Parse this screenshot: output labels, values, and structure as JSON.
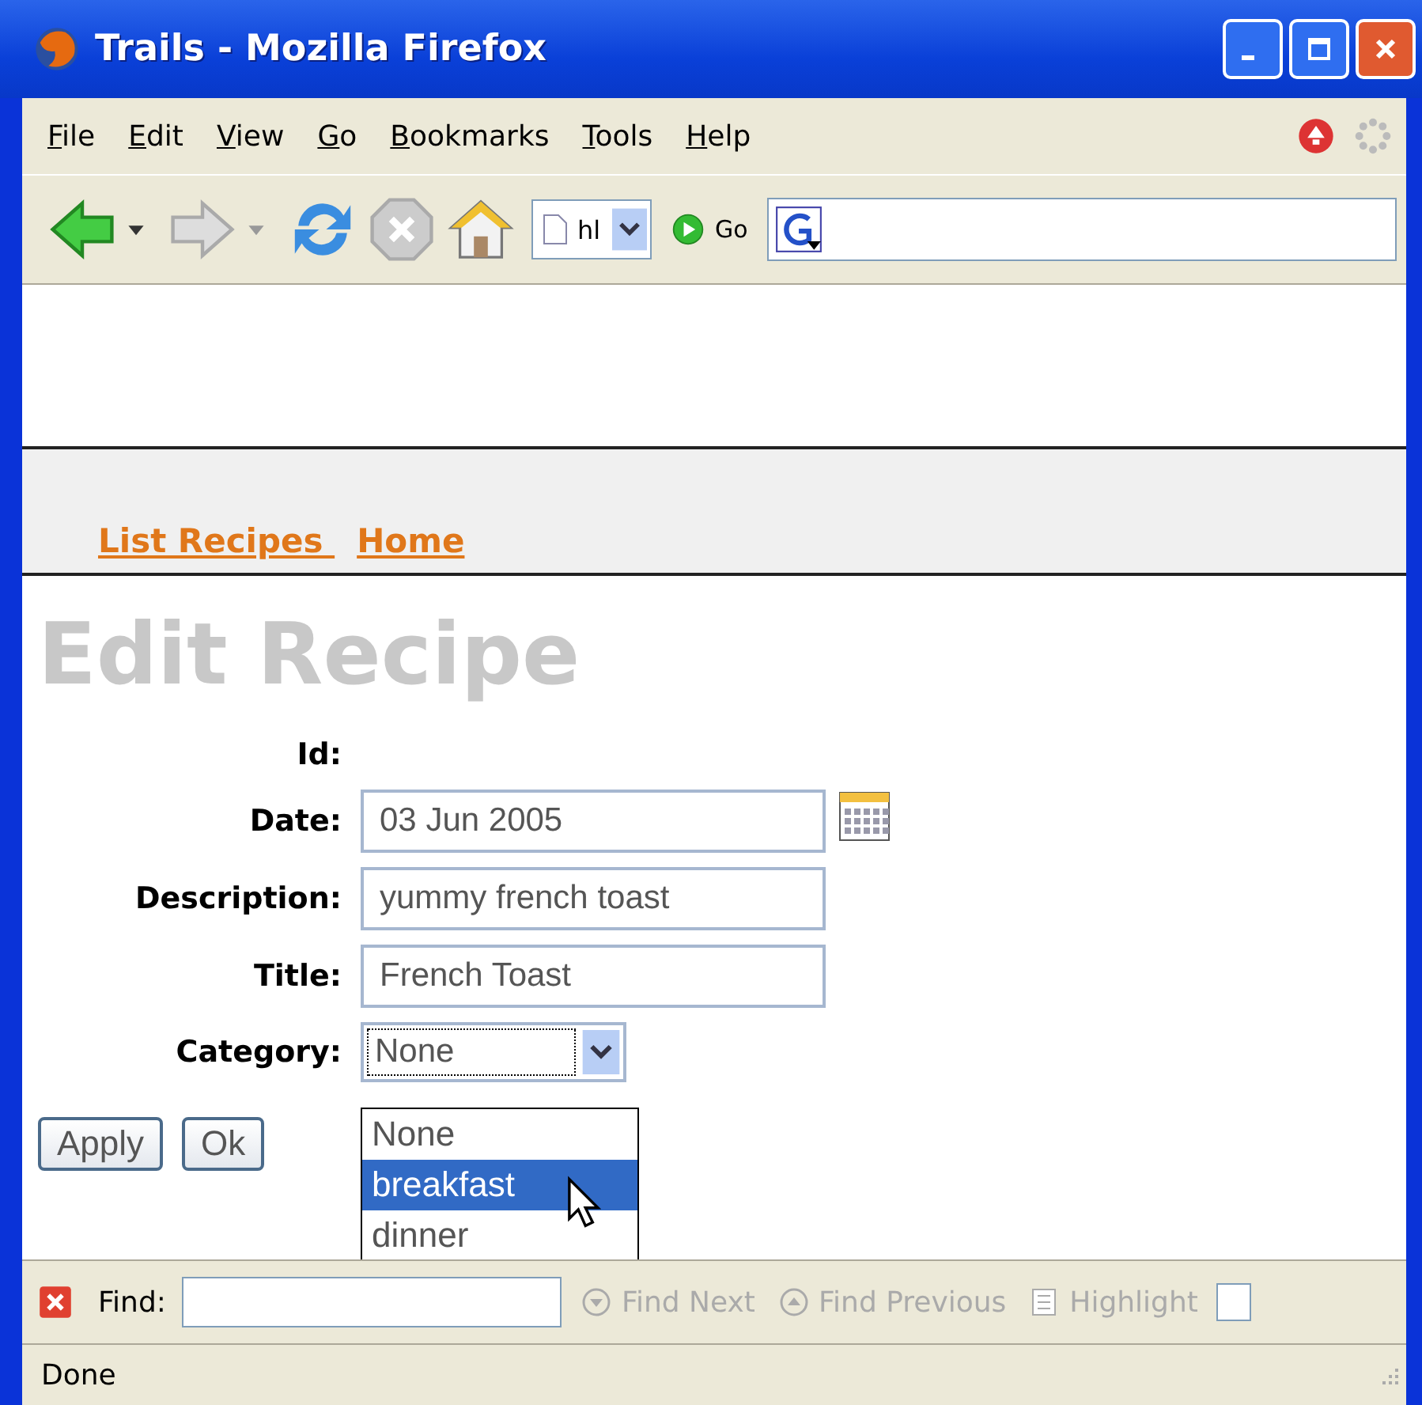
{
  "window": {
    "title": "Trails - Mozilla Firefox"
  },
  "menu": [
    "File",
    "Edit",
    "View",
    "Go",
    "Bookmarks",
    "Tools",
    "Help"
  ],
  "toolbar": {
    "url_value": "hl",
    "go_label": "Go"
  },
  "nav_links": [
    "List Recipes ",
    "Home"
  ],
  "heading": "Edit Recipe",
  "fields": [
    {
      "kind": "static",
      "label": "Id:"
    },
    {
      "kind": "date",
      "label": "Date:",
      "value": "03 Jun 2005"
    },
    {
      "kind": "text",
      "label": "Description:",
      "value": "yummy french toast"
    },
    {
      "kind": "text",
      "label": "Title:",
      "value": "French Toast"
    },
    {
      "kind": "select",
      "label": "Category:",
      "value": "None",
      "options": [
        {
          "label": "None",
          "highlighted": false
        },
        {
          "label": "breakfast",
          "highlighted": true
        },
        {
          "label": "dinner",
          "highlighted": false
        }
      ]
    }
  ],
  "buttons": [
    "Apply",
    "Ok"
  ],
  "find_bar": {
    "label": "Find:",
    "actions": [
      "Find Next",
      "Find Previous",
      "Highlight"
    ],
    "checkbox_checked": false
  },
  "status_bar": "Done"
}
